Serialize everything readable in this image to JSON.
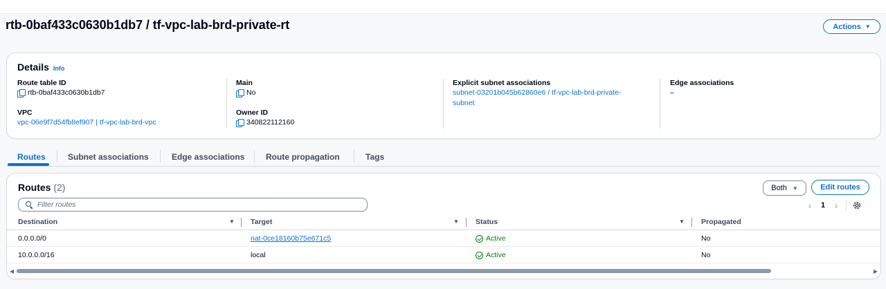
{
  "page": {
    "title": "rtb-0baf433c0630b1db7 / tf-vpc-lab-brd-private-rt",
    "actions_label": "Actions"
  },
  "details": {
    "title": "Details",
    "info_label": "Info",
    "route_table_id": {
      "label": "Route table ID",
      "value": "rtb-0baf433c0630b1db7"
    },
    "vpc": {
      "label": "VPC",
      "value": "vpc-06e9f7d54fb8ef907 | tf-vpc-lab-brd-vpc"
    },
    "main": {
      "label": "Main",
      "value": "No"
    },
    "owner_id": {
      "label": "Owner ID",
      "value": "340822112160"
    },
    "explicit_subnet": {
      "label": "Explicit subnet associations",
      "value_line1": "subnet-03201b045b62860e6 / tf-vpc-lab-brd-private-",
      "value_line2": "subnet"
    },
    "edge": {
      "label": "Edge associations",
      "value": "–"
    }
  },
  "tabs": [
    {
      "label": "Routes",
      "active": true
    },
    {
      "label": "Subnet associations"
    },
    {
      "label": "Edge associations"
    },
    {
      "label": "Route propagation"
    },
    {
      "label": "Tags"
    }
  ],
  "routes": {
    "title": "Routes",
    "count": "(2)",
    "filter_placeholder": "Filter routes",
    "both_label": "Both",
    "edit_label": "Edit routes",
    "page_number": "1",
    "columns": [
      "Destination",
      "Target",
      "Status",
      "Propagated"
    ],
    "rows": [
      {
        "destination": "0.0.0.0/0",
        "target": "nat-0ce18160b75e671c5",
        "target_is_link": true,
        "status": "Active",
        "propagated": "No"
      },
      {
        "destination": "10.0.0.0/16",
        "target": "local",
        "target_is_link": false,
        "status": "Active",
        "propagated": "No"
      }
    ]
  },
  "colors": {
    "accent": "#0972d3",
    "success": "#037f0c",
    "border": "#d5dbdb"
  }
}
